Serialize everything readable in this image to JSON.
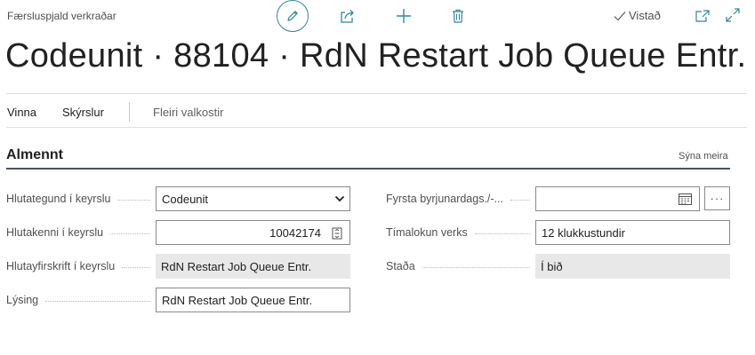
{
  "header": {
    "breadcrumb": "Færsluspjald verkraðar",
    "saved_label": "Vistað"
  },
  "page": {
    "title": "Codeunit · 88104 · RdN Restart Job Queue Entr."
  },
  "actions": {
    "process": "Vinna",
    "reports": "Skýrslur",
    "more": "Fleiri valkostir"
  },
  "general": {
    "title": "Almennt",
    "show_more": "Sýna meira",
    "object_type_label": "Hlutategund í keyrslu",
    "object_type_value": "Codeunit",
    "object_id_label": "Hlutakenni í keyrslu",
    "object_id_value": "10042174",
    "object_caption_label": "Hlutayfirskrift í keyrslu",
    "object_caption_value": "RdN Restart Job Queue Entr.",
    "description_label": "Lýsing",
    "description_value": "RdN Restart Job Queue Entr.",
    "earliest_start_label": "Fyrsta byrjunardags./-...",
    "earliest_start_value": "",
    "timeout_label": "Tímalokun verks",
    "timeout_value": "12 klukkustundir",
    "status_label": "Staða",
    "status_value": "Í bið"
  },
  "colors": {
    "accent": "#2f8796",
    "readonly_bg": "#e8e8e8",
    "section_rule": "#4a5360"
  },
  "icons": [
    "edit-icon",
    "share-icon",
    "plus-icon",
    "trash-icon",
    "checkmark-icon",
    "popout-icon",
    "expand-icon",
    "chevron-down-icon",
    "lookup-icon",
    "calendar-icon"
  ]
}
